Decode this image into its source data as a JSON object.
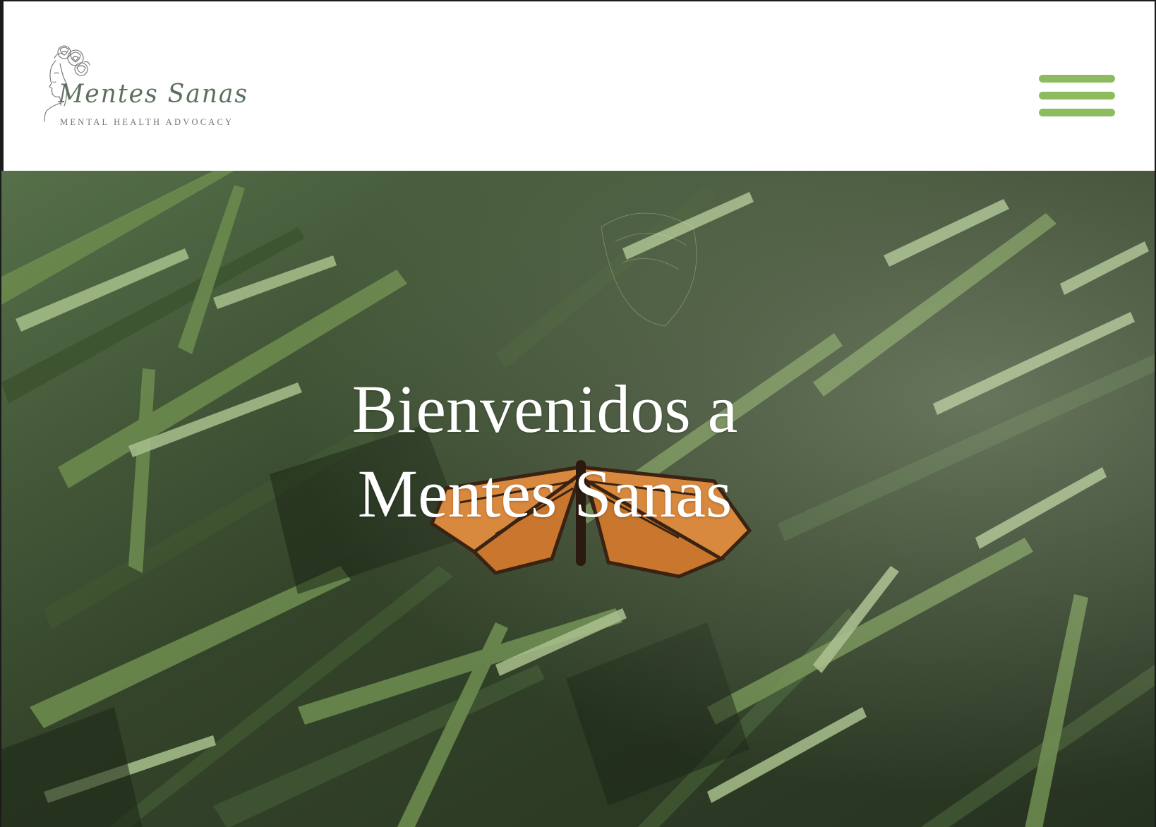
{
  "header": {
    "logo": {
      "name": "Mentes Sanas",
      "tagline": "MENTAL HEALTH ADVOCACY",
      "icon": "flower-woman-line-art-icon"
    },
    "menu": {
      "icon": "hamburger-menu-icon",
      "color": "#8dbc5f"
    }
  },
  "hero": {
    "title_line1": "Bienvenidos a",
    "title_line2": "Mentes Sanas",
    "background": "monarch butterfly resting on green grass blades",
    "colors": {
      "grass_dark": "#2c3a22",
      "grass_mid": "#5e7a45",
      "grass_light": "#a9bf8d",
      "butterfly": "#d9893e"
    }
  }
}
